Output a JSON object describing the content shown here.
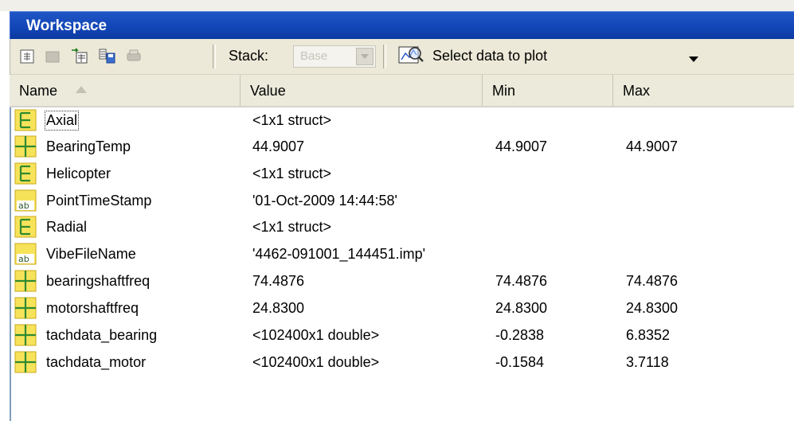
{
  "window": {
    "title": "Workspace"
  },
  "toolbar": {
    "stack_label": "Stack:",
    "stack_value": "Base",
    "plot_label": "Select data to plot",
    "buttons": [
      "new-variable-icon",
      "open-variable-icon",
      "import-data-icon",
      "save-workspace-icon",
      "print-icon"
    ]
  },
  "columns": {
    "name": "Name",
    "value": "Value",
    "min": "Min",
    "max": "Max"
  },
  "rows": [
    {
      "name": "Axial",
      "value": "<1x1 struct>",
      "min": "",
      "max": "",
      "icon": "struct-icon"
    },
    {
      "name": "BearingTemp",
      "value": "44.9007",
      "min": "44.9007",
      "max": "44.9007",
      "icon": "matrix-icon"
    },
    {
      "name": "Helicopter",
      "value": "<1x1 struct>",
      "min": "",
      "max": "",
      "icon": "struct-icon"
    },
    {
      "name": "PointTimeStamp",
      "value": "'01-Oct-2009 14:44:58'",
      "min": "",
      "max": "",
      "icon": "char-icon"
    },
    {
      "name": "Radial",
      "value": "<1x1 struct>",
      "min": "",
      "max": "",
      "icon": "struct-icon"
    },
    {
      "name": "VibeFileName",
      "value": "'4462-091001_144451.imp'",
      "min": "",
      "max": "",
      "icon": "char-icon"
    },
    {
      "name": "bearingshaftfreq",
      "value": "74.4876",
      "min": "74.4876",
      "max": "74.4876",
      "icon": "matrix-icon"
    },
    {
      "name": "motorshaftfreq",
      "value": "24.8300",
      "min": "24.8300",
      "max": "24.8300",
      "icon": "matrix-icon"
    },
    {
      "name": "tachdata_bearing",
      "value": "<102400x1 double>",
      "min": "-0.2838",
      "max": "6.8352",
      "icon": "matrix-icon"
    },
    {
      "name": "tachdata_motor",
      "value": "<102400x1 double>",
      "min": "-0.1584",
      "max": "3.7118",
      "icon": "matrix-icon"
    }
  ],
  "colors": {
    "title_bar": "#1245b6",
    "toolbar": "#ece9d8",
    "icon_fill": "#f7e35a",
    "icon_border": "#c9a81a"
  }
}
